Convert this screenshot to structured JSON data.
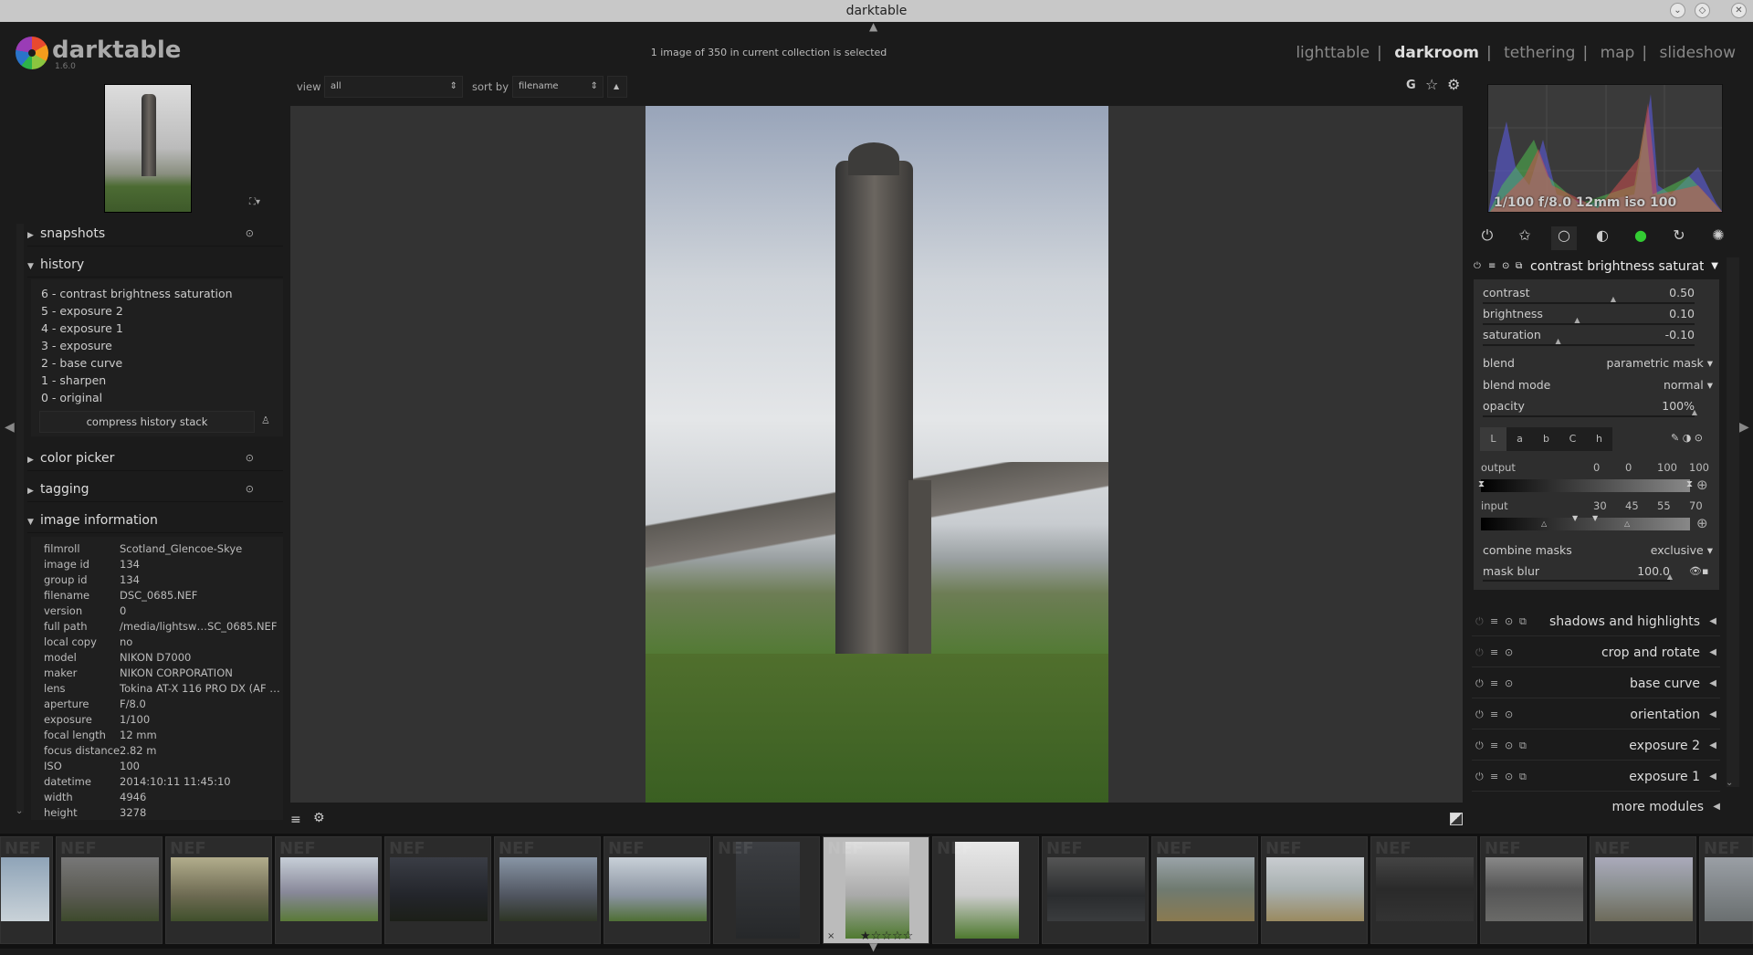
{
  "window": {
    "title": "darktable"
  },
  "header": {
    "app_name": "darktable",
    "version": "1.6.0",
    "status": "1 image of 350 in current collection is selected",
    "views": [
      "lighttable",
      "darkroom",
      "tethering",
      "map",
      "slideshow"
    ],
    "active_view": "darkroom",
    "separator": "|"
  },
  "toolbar": {
    "view_label": "view",
    "view_value": "all",
    "sort_label": "sort by",
    "sort_value": "filename",
    "sort_order": "▲",
    "icons": [
      "grouping-icon",
      "star-icon",
      "gear-icon"
    ],
    "grouping_label": "G"
  },
  "left": {
    "snapshots": "snapshots",
    "history_title": "history",
    "history": [
      "6 - contrast brightness saturation",
      "5 - exposure 2",
      "4 - exposure 1",
      "3 - exposure",
      "2 - base curve",
      "1 - sharpen",
      "0 - original"
    ],
    "compress": "compress history stack",
    "color_picker": "color picker",
    "tagging": "tagging",
    "image_information": "image information",
    "info": [
      [
        "filmroll",
        "Scotland_Glencoe-Skye"
      ],
      [
        "image id",
        "134"
      ],
      [
        "group id",
        "134"
      ],
      [
        "filename",
        "DSC_0685.NEF"
      ],
      [
        "version",
        "0"
      ],
      [
        "full path",
        "/media/lightsw…SC_0685.NEF"
      ],
      [
        "local copy",
        "no"
      ],
      [
        "model",
        "NIKON D7000"
      ],
      [
        "maker",
        "NIKON CORPORATION"
      ],
      [
        "lens",
        "Tokina AT-X 116 PRO DX (AF …"
      ],
      [
        "aperture",
        "F/8.0"
      ],
      [
        "exposure",
        "1/100"
      ],
      [
        "focal length",
        "12 mm"
      ],
      [
        "focus distance",
        "2.82 m"
      ],
      [
        "ISO",
        "100"
      ],
      [
        "datetime",
        "2014:10:11 11:45:10"
      ],
      [
        "width",
        "4946"
      ],
      [
        "height",
        "3278"
      ]
    ]
  },
  "right": {
    "histogram_info": "1/100 f/8.0 12mm iso 100",
    "module": {
      "title": "contrast brightness saturation",
      "sliders": [
        {
          "label": "contrast",
          "value": "0.50",
          "pos": 0.62
        },
        {
          "label": "brightness",
          "value": "0.10",
          "pos": 0.45
        },
        {
          "label": "saturation",
          "value": "-0.10",
          "pos": 0.36
        }
      ],
      "blend_label": "blend",
      "blend_value": "parametric mask",
      "blend_mode_label": "blend mode",
      "blend_mode_value": "normal",
      "opacity_label": "opacity",
      "opacity_value": "100%",
      "channels": [
        "L",
        "a",
        "b",
        "C",
        "h"
      ],
      "active_channel": "L",
      "output_label": "output",
      "output_values": [
        "0",
        "0",
        "100",
        "100"
      ],
      "input_label": "input",
      "input_values": [
        "30",
        "45",
        "55",
        "70"
      ],
      "combine_label": "combine masks",
      "combine_value": "exclusive",
      "mask_blur_label": "mask blur",
      "mask_blur_value": "100.0"
    },
    "modules": [
      "shadows and highlights",
      "crop and rotate",
      "base curve",
      "orientation",
      "exposure 2",
      "exposure 1"
    ],
    "more_modules": "more modules"
  },
  "filmstrip": {
    "selected_index": 8,
    "selected_rating": "★☆☆☆☆",
    "reject": "×",
    "badge": "NEF"
  }
}
